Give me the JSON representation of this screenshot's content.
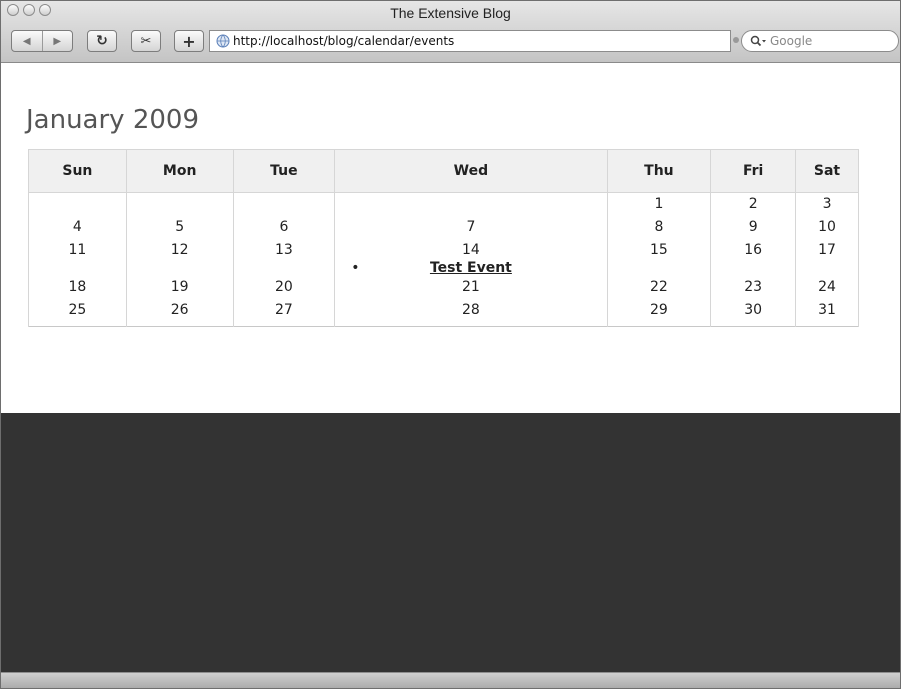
{
  "window": {
    "title": "The Extensive Blog"
  },
  "toolbar": {
    "back_icon": "◀",
    "forward_icon": "▶",
    "reload_icon": "↻",
    "clip_icon": "✂",
    "add_icon": "+",
    "url": "http://localhost/blog/calendar/events",
    "search_placeholder": "Google"
  },
  "calendar": {
    "title": "January 2009",
    "days": [
      "Sun",
      "Mon",
      "Tue",
      "Wed",
      "Thu",
      "Fri",
      "Sat"
    ],
    "weeks": [
      [
        "",
        "",
        "",
        "",
        "1",
        "2",
        "3"
      ],
      [
        "4",
        "5",
        "6",
        "7",
        "8",
        "9",
        "10"
      ],
      [
        "11",
        "12",
        "13",
        "14",
        "15",
        "16",
        "17"
      ],
      [
        "18",
        "19",
        "20",
        "21",
        "22",
        "23",
        "24"
      ],
      [
        "25",
        "26",
        "27",
        "28",
        "29",
        "30",
        "31"
      ]
    ],
    "event": {
      "date": "14",
      "label": "Test Event"
    }
  },
  "colors": {
    "footer": "#333333",
    "header_bg": "#f0f0f0"
  }
}
